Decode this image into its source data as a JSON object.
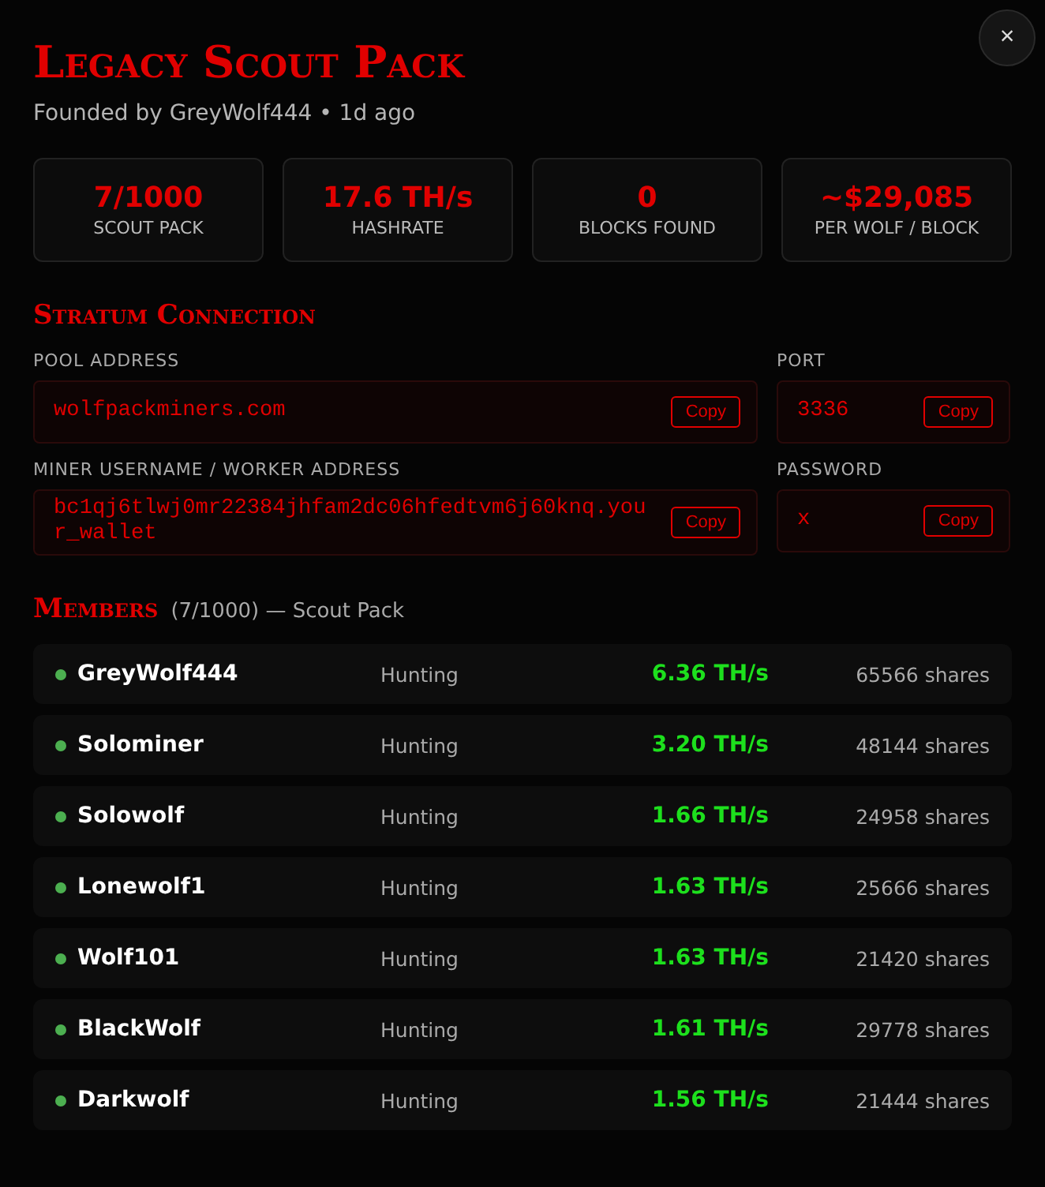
{
  "title": "Legacy Scout Pack",
  "subtitle": "Founded by GreyWolf444 • 1d ago",
  "close": "×",
  "stats": [
    {
      "value": "7/1000",
      "label": "SCOUT PACK"
    },
    {
      "value": "17.6 TH/s",
      "label": "HASHRATE"
    },
    {
      "value": "0",
      "label": "BLOCKS FOUND"
    },
    {
      "value": "~$29,085",
      "label": "PER WOLF / BLOCK"
    }
  ],
  "stratum": {
    "heading": "Stratum Connection",
    "fields": [
      {
        "label": "POOL ADDRESS",
        "value": "wolfpackminers.com",
        "button": "Copy"
      },
      {
        "label": "PORT",
        "value": "3336",
        "button": "Copy"
      },
      {
        "label": "MINER USERNAME / WORKER ADDRESS",
        "value": "bc1qj6tlwj0mr22384jhfam2dc06hfedtvm6j60knq.your_wallet",
        "button": "Copy"
      },
      {
        "label": "PASSWORD",
        "value": "x",
        "button": "Copy"
      }
    ]
  },
  "members": {
    "heading": "Members",
    "summary": "(7/1000) — Scout Pack",
    "rows": [
      {
        "name": "GreyWolf444",
        "status": "Hunting",
        "hashrate": "6.36 TH/s",
        "shares": "65566 shares"
      },
      {
        "name": "Solominer",
        "status": "Hunting",
        "hashrate": "3.20 TH/s",
        "shares": "48144 shares"
      },
      {
        "name": "Solowolf",
        "status": "Hunting",
        "hashrate": "1.66 TH/s",
        "shares": "24958 shares"
      },
      {
        "name": "Lonewolf1",
        "status": "Hunting",
        "hashrate": "1.63 TH/s",
        "shares": "25666 shares"
      },
      {
        "name": "Wolf101",
        "status": "Hunting",
        "hashrate": "1.63 TH/s",
        "shares": "21420 shares"
      },
      {
        "name": "BlackWolf",
        "status": "Hunting",
        "hashrate": "1.61 TH/s",
        "shares": "29778 shares"
      },
      {
        "name": "Darkwolf",
        "status": "Hunting",
        "hashrate": "1.56 TH/s",
        "shares": "21444 shares"
      }
    ]
  }
}
